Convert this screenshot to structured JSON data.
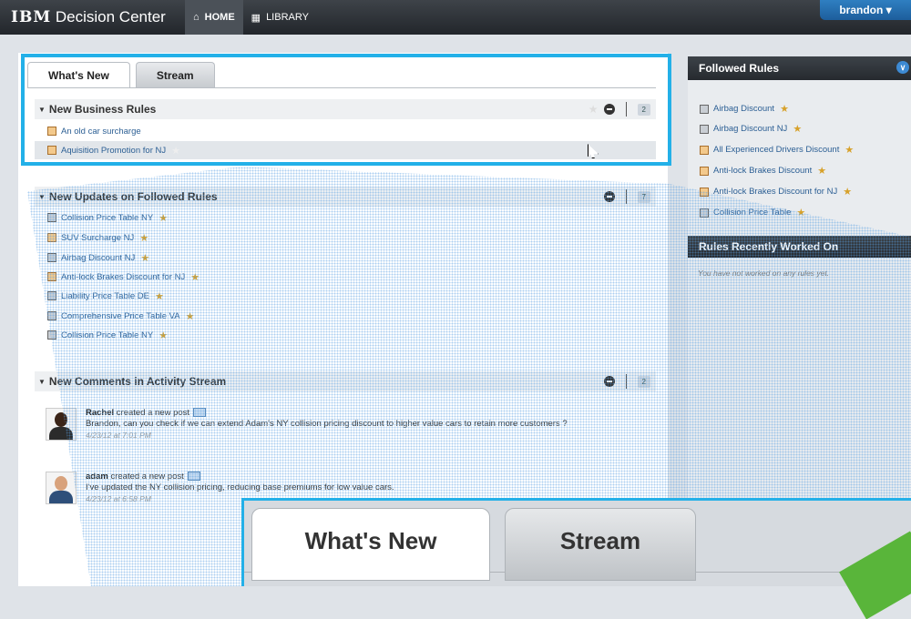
{
  "app": {
    "title": "Decision Center",
    "brand": "IBM"
  },
  "nav": {
    "home": "HOME",
    "library": "LIBRARY"
  },
  "user": {
    "name": "brandon"
  },
  "tabs": [
    "What's New",
    "Stream"
  ],
  "sections": {
    "new_business_rules": {
      "title": "New Business Rules",
      "count": "2",
      "items": [
        "An old car surcharge",
        "Aquisition Promotion for NJ"
      ]
    },
    "new_updates": {
      "title": "New Updates on Followed Rules",
      "count": "7",
      "items": [
        "Collision Price Table NY",
        "SUV Surcharge NJ",
        "Airbag Discount NJ",
        "Anti-lock Brakes Discount for NJ",
        "Liability Price Table DE",
        "Comprehensive Price Table VA",
        "Collision Price Table NY"
      ]
    },
    "new_comments": {
      "title": "New Comments in Activity Stream",
      "count": "2",
      "posts": [
        {
          "author": "Rachel",
          "action": "created a new post",
          "text": "Brandon, can you check if we can extend Adam's NY collision pricing discount to higher value cars to retain more customers ?",
          "date": "4/23/12 at 7:01 PM"
        },
        {
          "author": "adam",
          "action": "created a new post",
          "text": "I've updated the NY collision pricing, reducing base premiums for low value cars.",
          "date": "4/23/12 at 6:58 PM"
        }
      ]
    }
  },
  "followed_rules": {
    "title": "Followed Rules",
    "items": [
      "Airbag Discount",
      "Airbag Discount NJ",
      "All Experienced Drivers Discount",
      "Anti-lock Brakes Discount",
      "Anti-lock Brakes Discount for NJ",
      "Collision Price Table"
    ]
  },
  "recent": {
    "title": "Rules Recently Worked On",
    "empty_text": "You have not worked on any rules yet."
  },
  "zoom": {
    "tabs": [
      "What's New",
      "Stream"
    ]
  },
  "colors": {
    "highlight": "#23b0e8",
    "accent_green": "#59b53a",
    "link": "#2c5f94"
  }
}
